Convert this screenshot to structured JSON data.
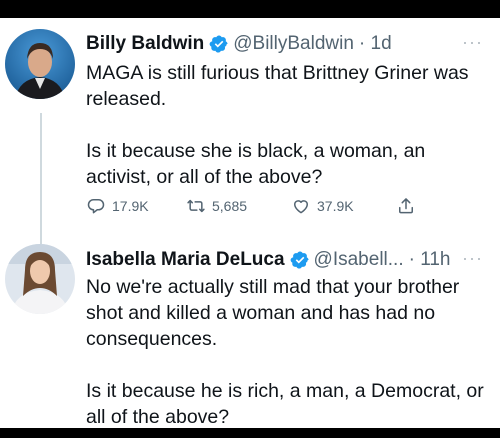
{
  "tweet1": {
    "name": "Billy Baldwin",
    "handle": "@BillyBaldwin",
    "time": "· 1d",
    "line1": "MAGA is still furious that Brittney Griner was released.",
    "line2": "Is it because she is black, a woman, an activist, or all of the above?",
    "stats": {
      "replies": "17.9K",
      "retweets": "5,685",
      "likes": "37.9K"
    }
  },
  "tweet2": {
    "name": "Isabella Maria DeLuca",
    "handle": "@Isabell...",
    "time": "· 11h",
    "line1": "No we're actually still mad that your brother shot and killed a woman and has had no consequences.",
    "line2": "Is it because he is rich, a man, a Democrat, or all of the above?"
  },
  "icons": {
    "verified": "verified-badge-icon",
    "more": "more-dots-icon",
    "reply": "reply-icon",
    "retweet": "retweet-icon",
    "like": "heart-icon",
    "share": "share-icon"
  },
  "colors": {
    "verified": "#1d9bf0",
    "text": "#0f1419",
    "secondary": "#536471"
  }
}
